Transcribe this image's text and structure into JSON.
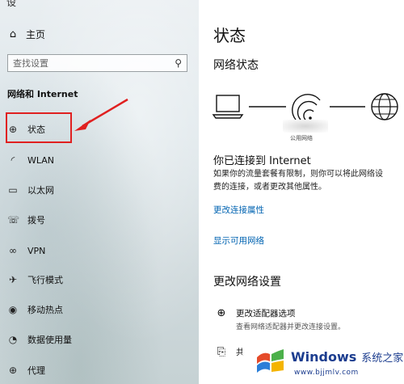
{
  "sidebar": {
    "top_cut_text": "设",
    "home_label": "主页",
    "search_placeholder": "查找设置",
    "section_title": "网络和 Internet",
    "items": [
      {
        "label": "状态",
        "icon": "globe-icon"
      },
      {
        "label": "WLAN",
        "icon": "wifi-icon"
      },
      {
        "label": "以太网",
        "icon": "ethernet-icon"
      },
      {
        "label": "拨号",
        "icon": "dialup-icon"
      },
      {
        "label": "VPN",
        "icon": "vpn-icon"
      },
      {
        "label": "飞行模式",
        "icon": "airplane-icon"
      },
      {
        "label": "移动热点",
        "icon": "hotspot-icon"
      },
      {
        "label": "数据使用量",
        "icon": "data-usage-icon"
      },
      {
        "label": "代理",
        "icon": "proxy-icon"
      }
    ]
  },
  "main": {
    "title": "状态",
    "network_status_heading": "网络状态",
    "network_label": "公用网络",
    "connected_text": "你已连接到 Internet",
    "description": "如果你的流量套餐有限制，则你可以将此网络设置为按流量计费的连接，或者更改其他属性。",
    "description_line1": "如果你的流量套餐有限制，则你可以将此网络设",
    "description_line2": "费的连接，或者更改其他属性。",
    "link_change_properties": "更改连接属性",
    "link_show_networks": "显示可用网络",
    "change_settings_heading": "更改网络设置",
    "option_adapter_title": "更改适配器选项",
    "option_adapter_sub": "查看网络适配器并更改连接设置。",
    "option_sharing_title": "共"
  },
  "watermark": {
    "brand": "Windows",
    "brand_cn": "系统之家",
    "url": "www.bjjmlv.com"
  },
  "colors": {
    "accent_link": "#0063b1",
    "highlight": "#e02020",
    "watermark": "#1c3d8f"
  }
}
